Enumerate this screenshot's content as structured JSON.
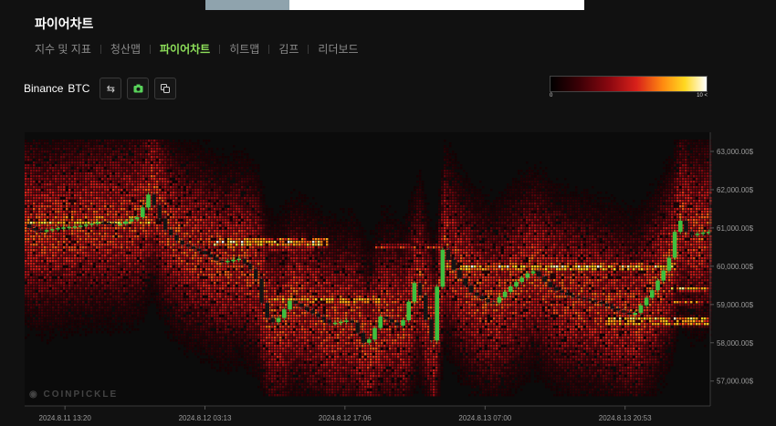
{
  "page_title": "파이어차트",
  "tabs": [
    {
      "label": "지수 및 지표",
      "active": false
    },
    {
      "label": "청산맵",
      "active": false
    },
    {
      "label": "파이어차트",
      "active": true
    },
    {
      "label": "히트맵",
      "active": false
    },
    {
      "label": "김프",
      "active": false
    },
    {
      "label": "리더보드",
      "active": false
    }
  ],
  "toolbar": {
    "exchange": "Binance",
    "symbol": "BTC",
    "buttons": [
      {
        "icon": "swap-arrows-icon"
      },
      {
        "icon": "camera-icon"
      },
      {
        "icon": "copy-icon"
      }
    ]
  },
  "color_scale": {
    "min_label": "0",
    "max_label": "10 <",
    "colors": [
      "#000000",
      "#3a0006",
      "#8c0810",
      "#d8201a",
      "#ff8a10",
      "#ffd820",
      "#ffffff"
    ]
  },
  "watermark": "COINPICKLE",
  "chart_data": {
    "type": "heatmap",
    "y_tick_labels": [
      "63,000.00$",
      "62,000.00$",
      "61,000.00$",
      "60,000.00$",
      "59,000.00$",
      "58,000.00$",
      "57,000.00$"
    ],
    "y_ticks": [
      63000,
      62000,
      61000,
      60000,
      59000,
      58000,
      57000
    ],
    "ylim": [
      56350,
      63500
    ],
    "x_tick_labels": [
      "2024.8.11 13:20",
      "2024.8.12 03:13",
      "2024.8.12 17:06",
      "2024.8.13 07:00",
      "2024.8.13 20:53"
    ],
    "x_range": [
      "2024.8.11 09:20",
      "2024.8.14 05:20"
    ],
    "x_ticks": [
      "2024.8.11 13:20",
      "2024.8.12 03:13",
      "2024.8.12 17:06",
      "2024.8.13 07:00",
      "2024.8.13 20:53"
    ],
    "price_path": [
      [
        "2024.8.11 09:20",
        61100
      ],
      [
        "2024.8.11 11:00",
        60900
      ],
      [
        "2024.8.11 13:00",
        61000
      ],
      [
        "2024.8.11 15:00",
        61050
      ],
      [
        "2024.8.11 17:00",
        61150
      ],
      [
        "2024.8.11 19:00",
        61100
      ],
      [
        "2024.8.11 21:00",
        61300
      ],
      [
        "2024.8.11 22:00",
        61900
      ],
      [
        "2024.8.11 23:30",
        61000
      ],
      [
        "2024.8.12 01:00",
        60600
      ],
      [
        "2024.8.12 03:00",
        60400
      ],
      [
        "2024.8.12 05:00",
        60100
      ],
      [
        "2024.8.12 07:00",
        60200
      ],
      [
        "2024.8.12 08:30",
        59800
      ],
      [
        "2024.8.12 09:30",
        58700
      ],
      [
        "2024.8.12 10:30",
        58500
      ],
      [
        "2024.8.12 12:00",
        59100
      ],
      [
        "2024.8.12 14:00",
        58800
      ],
      [
        "2024.8.12 16:00",
        58500
      ],
      [
        "2024.8.12 18:00",
        58600
      ],
      [
        "2024.8.12 19:30",
        57900
      ],
      [
        "2024.8.12 21:00",
        58700
      ],
      [
        "2024.8.12 23:00",
        58400
      ],
      [
        "2024.8.13 00:30",
        59700
      ],
      [
        "2024.8.13 02:00",
        58000
      ],
      [
        "2024.8.13 03:00",
        60500
      ],
      [
        "2024.8.13 04:30",
        59800
      ],
      [
        "2024.8.13 06:00",
        59300
      ],
      [
        "2024.8.13 08:00",
        59000
      ],
      [
        "2024.8.13 10:00",
        59500
      ],
      [
        "2024.8.13 12:00",
        59900
      ],
      [
        "2024.8.13 14:00",
        59400
      ],
      [
        "2024.8.13 16:00",
        59200
      ],
      [
        "2024.8.13 18:00",
        59100
      ],
      [
        "2024.8.13 20:00",
        58900
      ],
      [
        "2024.8.13 22:00",
        58700
      ],
      [
        "2024.8.14 00:00",
        59400
      ],
      [
        "2024.8.14 01:30",
        60100
      ],
      [
        "2024.8.14 02:30",
        61300
      ],
      [
        "2024.8.14 03:30",
        60800
      ],
      [
        "2024.8.14 05:20",
        60900
      ]
    ],
    "liquidity_bands": [
      {
        "price": 61150,
        "from": "2024.8.11 09:20",
        "to": "2024.8.11 22:30",
        "intensity": 0.85
      },
      {
        "price": 61250,
        "from": "2024.8.11 09:20",
        "to": "2024.8.11 21:30",
        "intensity": 0.65
      },
      {
        "price": 60650,
        "from": "2024.8.12 04:00",
        "to": "2024.8.12 15:30",
        "intensity": 0.95
      },
      {
        "price": 60550,
        "from": "2024.8.12 04:00",
        "to": "2024.8.12 15:30",
        "intensity": 0.8
      },
      {
        "price": 60450,
        "from": "2024.8.12 04:00",
        "to": "2024.8.12 14:00",
        "intensity": 0.55
      },
      {
        "price": 59150,
        "from": "2024.8.12 10:00",
        "to": "2024.8.12 21:00",
        "intensity": 0.8
      },
      {
        "price": 59050,
        "from": "2024.8.12 10:00",
        "to": "2024.8.12 21:00",
        "intensity": 0.65
      },
      {
        "price": 60500,
        "from": "2024.8.12 20:00",
        "to": "2024.8.13 04:00",
        "intensity": 0.55
      },
      {
        "price": 60000,
        "from": "2024.8.13 03:00",
        "to": "2024.8.14 02:00",
        "intensity": 0.9
      },
      {
        "price": 59900,
        "from": "2024.8.13 03:00",
        "to": "2024.8.14 02:00",
        "intensity": 0.75
      },
      {
        "price": 59800,
        "from": "2024.8.13 05:00",
        "to": "2024.8.13 23:00",
        "intensity": 0.5
      },
      {
        "price": 59400,
        "from": "2024.8.14 01:30",
        "to": "2024.8.14 05:20",
        "intensity": 0.85
      },
      {
        "price": 59050,
        "from": "2024.8.14 01:30",
        "to": "2024.8.14 05:20",
        "intensity": 0.65
      },
      {
        "price": 58600,
        "from": "2024.8.13 19:00",
        "to": "2024.8.14 05:20",
        "intensity": 0.95
      },
      {
        "price": 58500,
        "from": "2024.8.13 19:00",
        "to": "2024.8.14 05:20",
        "intensity": 0.75
      },
      {
        "price": 61400,
        "from": "2024.8.14 02:00",
        "to": "2024.8.14 05:20",
        "intensity": 0.55
      }
    ]
  }
}
